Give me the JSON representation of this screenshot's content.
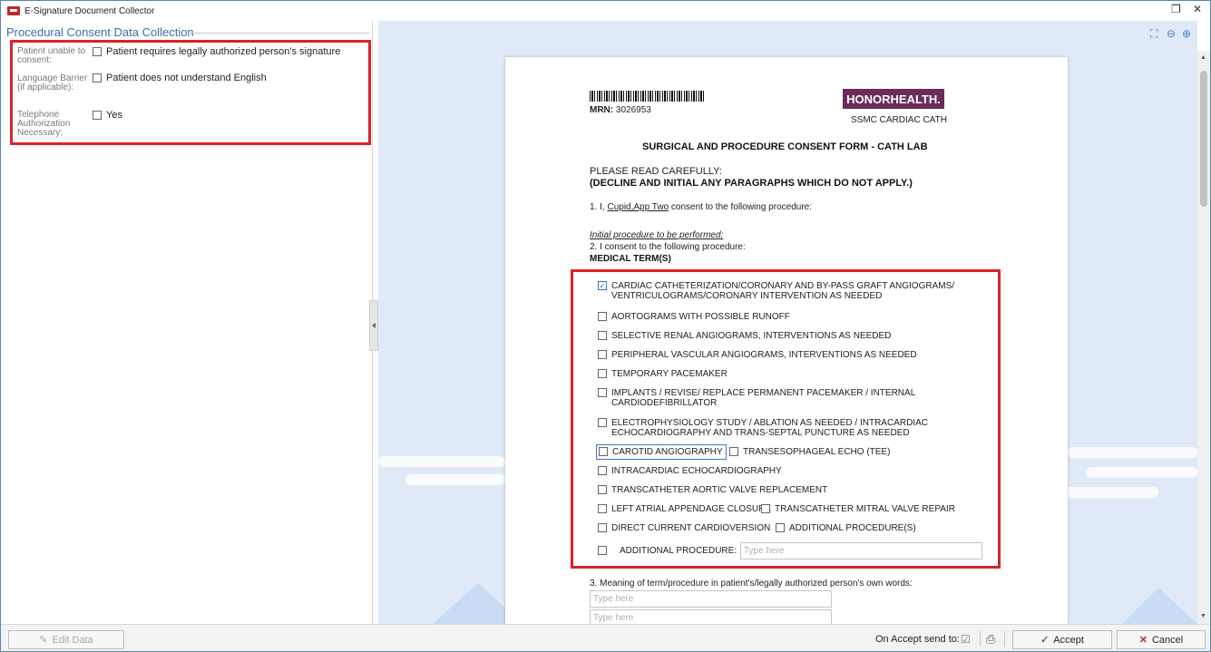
{
  "window": {
    "title": "E-Signature Document Collector",
    "controls": {
      "restore": "❐",
      "close": "✕"
    }
  },
  "left_panel": {
    "section_title": "Procedural Consent Data Collection",
    "rows": [
      {
        "label": "Patient unable to consent:",
        "option": "Patient requires legally authorized person's signature",
        "checked": false
      },
      {
        "label": "Language Barrier (if applicable):",
        "option": "Patient does not understand English",
        "checked": false
      },
      {
        "label": "Telephone Authorization Necessary:",
        "option": "Yes",
        "checked": false
      }
    ]
  },
  "viewer": {
    "tools": [
      "fit-page-icon",
      "zoom-out-icon",
      "zoom-in-icon"
    ]
  },
  "document": {
    "mrn_label": "MRN:",
    "mrn_value": "3026953",
    "logo_text": "HONORHEALTH.",
    "facility": "SSMC CARDIAC CATH",
    "form_title": "SURGICAL AND PROCEDURE CONSENT FORM - CATH LAB",
    "read_carefully": "PLEASE READ CAREFULLY:",
    "decline_note": "(DECLINE AND INITIAL ANY PARAGRAPHS WHICH DO NOT APPLY.)",
    "line1_prefix": "1. I,",
    "patient_name": "Cupid,App Two",
    "line1_suffix": "consent to the following procedure:",
    "initial_heading": "Initial procedure to be performed:",
    "line2": "2. I consent to the following procedure:",
    "medical_terms": "MEDICAL TERM(S)",
    "procedures": [
      {
        "line1": "CARDIAC CATHETERIZATION/CORONARY AND BY-PASS GRAFT ANGIOGRAMS/",
        "line2": "VENTRICULOGRAMS/CORONARY INTERVENTION  AS NEEDED",
        "checked": true
      },
      {
        "line1": "AORTOGRAMS WITH POSSIBLE RUNOFF",
        "line2": "",
        "checked": false
      },
      {
        "line1": "SELECTIVE RENAL ANGIOGRAMS, INTERVENTIONS AS NEEDED",
        "line2": "",
        "checked": false
      },
      {
        "line1": "PERIPHERAL VASCULAR ANGIOGRAMS,  INTERVENTIONS AS NEEDED",
        "line2": "",
        "checked": false
      },
      {
        "line1": "TEMPORARY PACEMAKER",
        "line2": "",
        "checked": false
      },
      {
        "line1": "IMPLANTS / REVISE/ REPLACE  PERMANENT PACEMAKER / INTERNAL",
        "line2": "CARDIODEFIBRILLATOR",
        "checked": false
      },
      {
        "line1": "ELECTROPHYSIOLOGY STUDY / ABLATION AS  NEEDED / INTRACARDIAC",
        "line2": "ECHOCARDIOGRAPHY  AND TRANS-SEPTAL PUNCTURE AS NEEDED",
        "checked": false
      }
    ],
    "pair_rows": [
      {
        "a": "CAROTID ANGIOGRAPHY",
        "b": "TRANSESOPHAGEAL ECHO (TEE)"
      },
      {
        "a": "INTRACARDIAC ECHOCARDIOGRAPHY",
        "b": ""
      },
      {
        "a": "TRANSCATHETER AORTIC VALVE  REPLACEMENT",
        "b": ""
      },
      {
        "a": "LEFT ATRIAL APPENDAGE CLOSURE",
        "b": "TRANSCATHETER MITRAL VALVE REPAIR"
      },
      {
        "a": "DIRECT CURRENT CARDIOVERSION",
        "b": "ADDITIONAL PROCEDURE(S)"
      }
    ],
    "additional_label": "ADDITIONAL PROCEDURE:",
    "placeholder": "Type here",
    "line3": "3. Meaning of term/procedure in patient's/legally authorized person's own words:"
  },
  "bottom_bar": {
    "edit_data": "Edit Data",
    "on_accept": "On Accept send to:",
    "accept": "Accept",
    "cancel": "Cancel"
  },
  "colors": {
    "highlight": "#d9232a",
    "accent": "#3a6ea8",
    "logo": "#6b2c5b"
  }
}
